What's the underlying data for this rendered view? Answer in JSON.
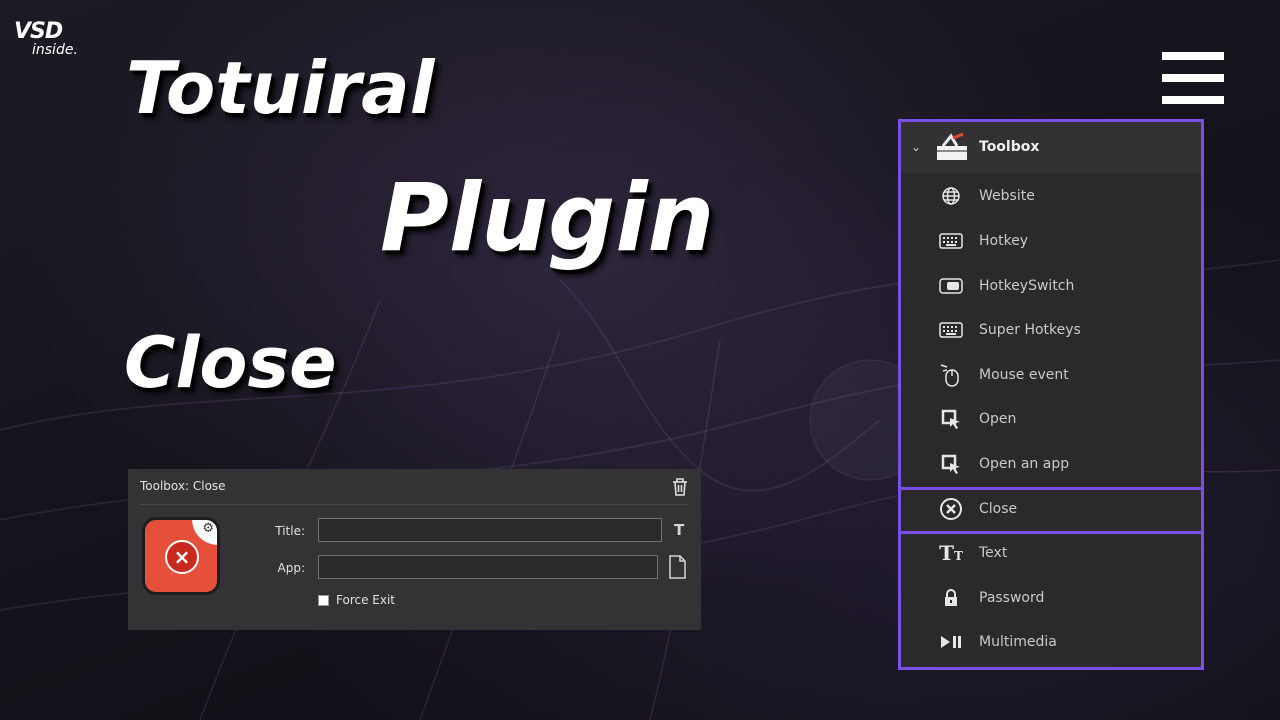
{
  "logo": {
    "mark": "VSD",
    "sub": "inside."
  },
  "titles": {
    "line1": "Totuiral",
    "line2": "Plugin",
    "line3": "Close"
  },
  "toolbox": {
    "header": "Toolbox",
    "items": [
      {
        "label": "Website",
        "icon": "globe-icon"
      },
      {
        "label": "Hotkey",
        "icon": "keyboard-icon"
      },
      {
        "label": "HotkeySwitch",
        "icon": "switch-icon"
      },
      {
        "label": "Super Hotkeys",
        "icon": "keyboard-icon"
      },
      {
        "label": "Mouse event",
        "icon": "mouse-icon"
      },
      {
        "label": "Open",
        "icon": "cursor-icon"
      },
      {
        "label": "Open an app",
        "icon": "cursor-icon"
      },
      {
        "label": "Close",
        "icon": "close-circle-icon"
      },
      {
        "label": "Text",
        "icon": "text-icon"
      },
      {
        "label": "Password",
        "icon": "lock-icon"
      },
      {
        "label": "Multimedia",
        "icon": "play-pause-icon"
      }
    ],
    "highlight_color": "#7b4fe6"
  },
  "dialog": {
    "title": "Toolbox:  Close",
    "title_field": {
      "label": "Title:",
      "value": ""
    },
    "app_field": {
      "label": "App:",
      "value": ""
    },
    "title_icon_glyph": "T",
    "force_exit": {
      "label": "Force Exit",
      "checked": false
    },
    "icon_color": "#e6503a"
  }
}
